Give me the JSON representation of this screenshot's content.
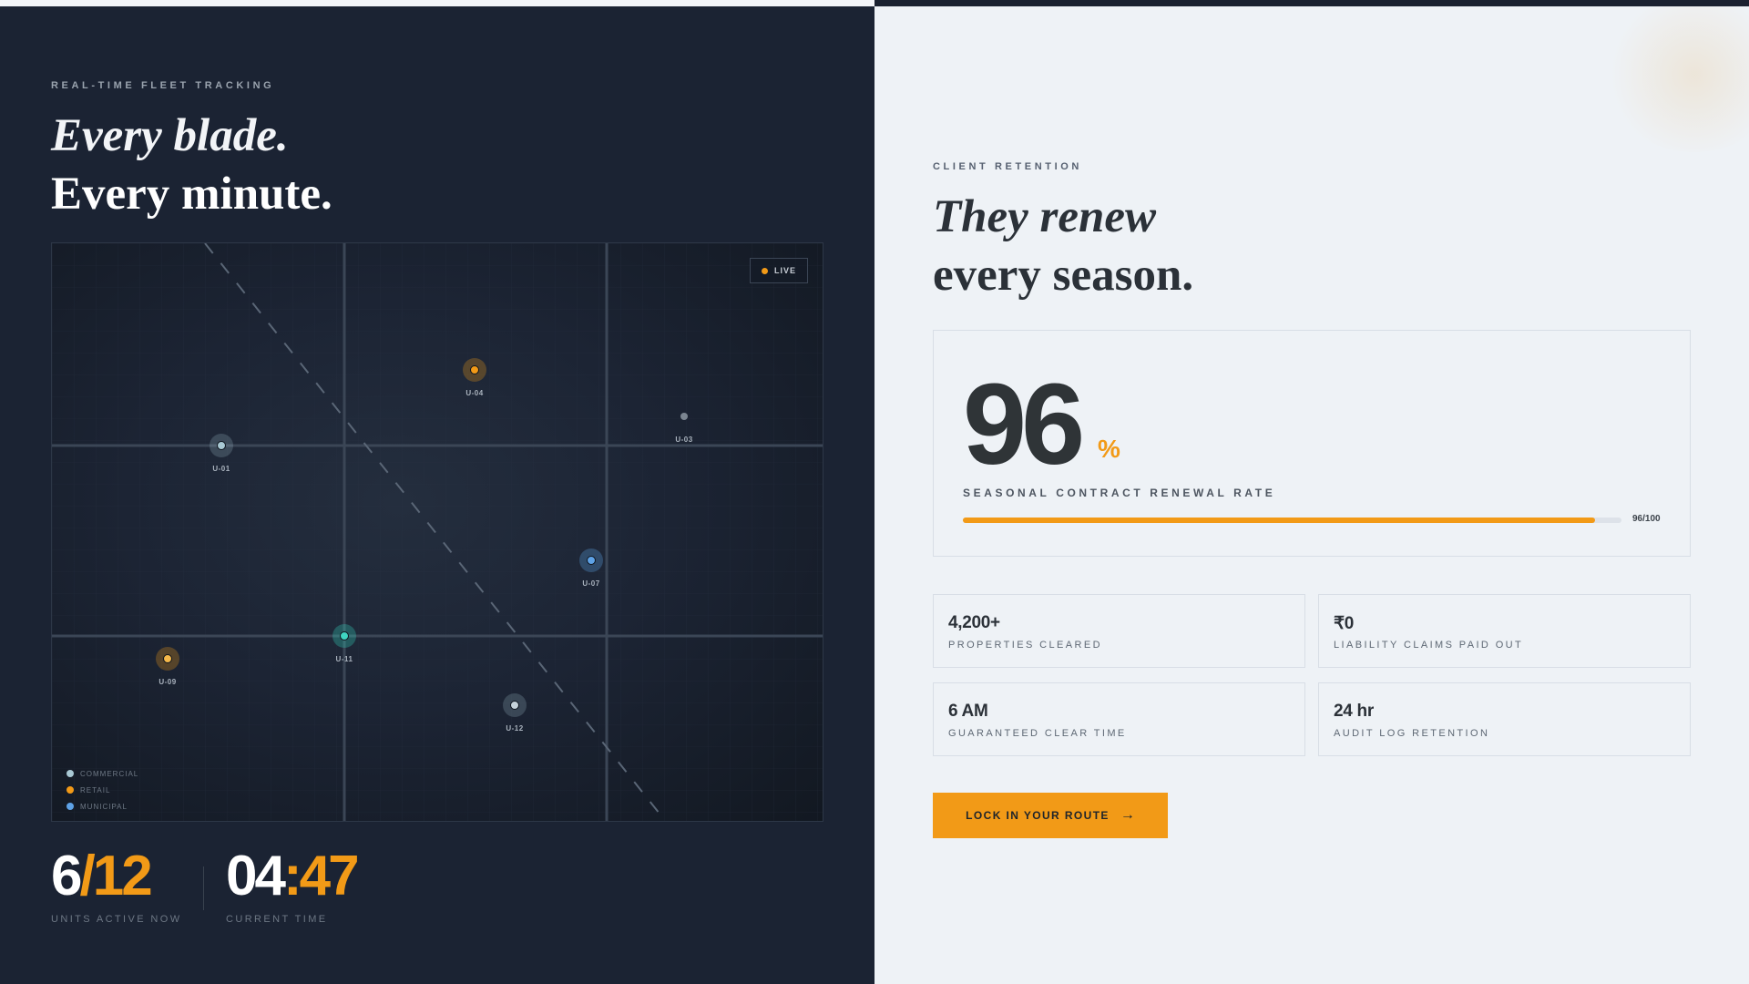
{
  "fleet": {
    "eyebrow": "REAL-TIME FLEET TRACKING",
    "headline_italic": "Every blade.",
    "headline_bold": "Every minute.",
    "live_label": "LIVE",
    "units": [
      {
        "id": "U-04",
        "type": "retail"
      },
      {
        "id": "U-03",
        "type": "idle"
      },
      {
        "id": "U-01",
        "type": "commercial"
      },
      {
        "id": "U-07",
        "type": "municipal"
      },
      {
        "id": "U-11",
        "type": "active"
      },
      {
        "id": "U-09",
        "type": "retail"
      },
      {
        "id": "U-12",
        "type": "commercial"
      }
    ],
    "legend": [
      {
        "label": "COMMERCIAL",
        "color": "#a9c9d4"
      },
      {
        "label": "RETAIL",
        "color": "#f29a17"
      },
      {
        "label": "MUNICIPAL",
        "color": "#5ea2e6"
      }
    ],
    "units_active": {
      "current": "6",
      "separator": "/",
      "total": "12",
      "label": "UNITS ACTIVE NOW"
    },
    "clock": {
      "hours": "04",
      "colon": ":",
      "minutes": "47",
      "label": "CURRENT TIME"
    }
  },
  "retention": {
    "eyebrow": "CLIENT RETENTION",
    "headline_italic": "They renew",
    "headline_bold": "every season.",
    "rate_value": "96",
    "rate_unit": "%",
    "rate_label": "SEASONAL CONTRACT RENEWAL RATE",
    "rate_fraction": 0.96,
    "rate_score": "96/100",
    "stats": [
      {
        "value": "4,200+",
        "label": "PROPERTIES CLEARED"
      },
      {
        "value": "₹0",
        "label": "LIABILITY CLAIMS PAID OUT"
      },
      {
        "value": "6 AM",
        "label": "GUARANTEED CLEAR TIME"
      },
      {
        "value": "24 hr",
        "label": "AUDIT LOG RETENTION"
      }
    ],
    "cta_label": "LOCK IN YOUR ROUTE",
    "cta_icon": "arrow-right-icon"
  },
  "colors": {
    "accent": "#f29a17",
    "dark_panel": "#1b2333",
    "light_panel": "#eef2f6"
  }
}
